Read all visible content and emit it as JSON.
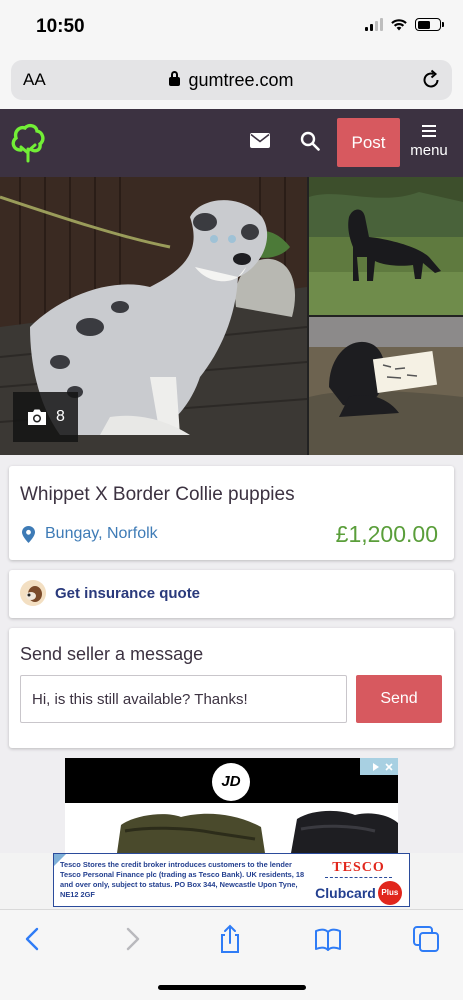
{
  "status_bar": {
    "time": "10:50"
  },
  "browser": {
    "text_size_label": "AA",
    "url": "gumtree.com",
    "icons": [
      "lock-icon",
      "reload-icon"
    ]
  },
  "header": {
    "post_label": "Post",
    "menu_label": "menu",
    "icons": [
      "gumtree-logo-icon",
      "mail-icon",
      "search-icon",
      "hamburger-icon"
    ],
    "brand_color": "#3c3241",
    "accent_color": "#d7595f",
    "logo_color": "#72ef36"
  },
  "gallery": {
    "photo_count": "8",
    "photos": [
      "merle-collie-dog-photo",
      "black-whippet-standing-photo",
      "black-puppy-with-note-photo"
    ]
  },
  "listing": {
    "title": "Whippet X Border Collie puppies",
    "location": "Bungay, Norfolk",
    "price": "£1,200.00",
    "price_color": "#5a9e3a",
    "location_color": "#3e7bb6"
  },
  "insurance": {
    "label": "Get insurance quote"
  },
  "message": {
    "title": "Send seller a message",
    "input_value": "Hi, is this still available? Thanks!",
    "send_label": "Send"
  },
  "ad": {
    "brand_logo": "JD"
  },
  "tesco_ad": {
    "text": "Tesco Stores the credit broker introduces customers to the lender Tesco Personal Finance plc (trading as Tesco Bank). UK residents, 18 and over only, subject to status. PO Box 344, Newcastle Upon Tyne, NE12 2GF",
    "brand": "TESCO",
    "clubcard": "Clubcard",
    "plus": "Plus"
  },
  "toolbar": {
    "icons": [
      "back-icon",
      "forward-icon",
      "share-icon",
      "bookmarks-icon",
      "tabs-icon"
    ]
  }
}
